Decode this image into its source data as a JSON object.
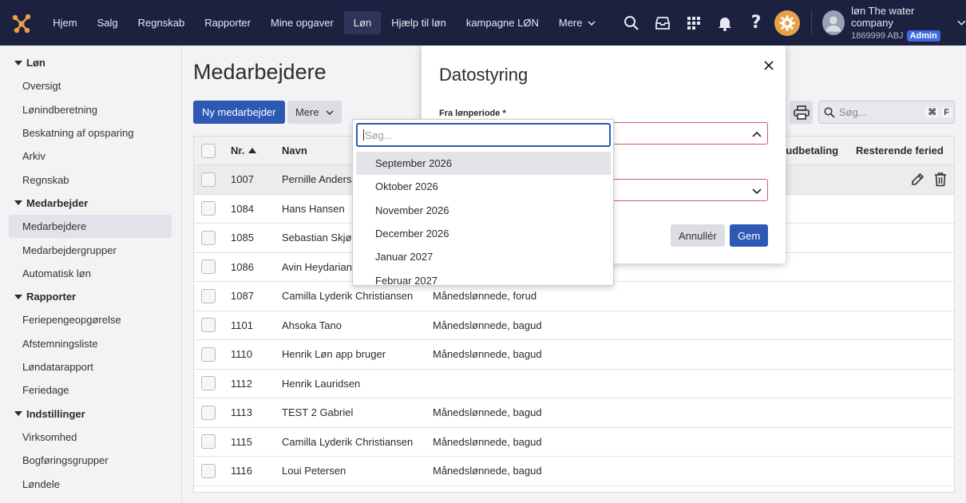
{
  "topnav": {
    "items": [
      "Hjem",
      "Salg",
      "Regnskab",
      "Rapporter",
      "Mine opgaver",
      "Løn",
      "Hjælp til løn",
      "kampagne LØN"
    ],
    "active_index": 5,
    "more_label": "Mere"
  },
  "user": {
    "name": "løn The water company",
    "sub": "1869999 ABJ",
    "role": "Admin"
  },
  "sidebar": {
    "sections": [
      {
        "title": "Løn",
        "items": [
          "Oversigt",
          "Lønindberetning",
          "Beskatning af opsparing",
          "Arkiv",
          "Regnskab"
        ]
      },
      {
        "title": "Medarbejder",
        "items": [
          "Medarbejdere",
          "Medarbejdergrupper",
          "Automatisk løn"
        ]
      },
      {
        "title": "Rapporter",
        "items": [
          "Feriepengeopgørelse",
          "Afstemningsliste",
          "Løndatarapport",
          "Feriedage"
        ]
      },
      {
        "title": "Indstillinger",
        "items": [
          "Virksomhed",
          "Bogføringsgrupper",
          "Løndele"
        ]
      }
    ],
    "active_item": "Medarbejdere"
  },
  "main": {
    "title": "Medarbejdere",
    "new_button": "Ny medarbejder",
    "more_button": "Mere",
    "search_placeholder": "Søg...",
    "search_kbd_1": "⌘",
    "search_kbd_2": "F"
  },
  "table": {
    "columns": {
      "nr": "Nr.",
      "navn": "Navn",
      "udb": "ste udbetaling",
      "rest": "Resterende feried"
    },
    "rows": [
      {
        "nr": "1007",
        "navn": "Pernille Andersen",
        "gruppe": ""
      },
      {
        "nr": "1084",
        "navn": "Hans Hansen",
        "gruppe": ""
      },
      {
        "nr": "1085",
        "navn": "Sebastian Skjødt",
        "gruppe": ""
      },
      {
        "nr": "1086",
        "navn": "Avin Heydarian",
        "gruppe": ""
      },
      {
        "nr": "1087",
        "navn": "Camilla Lyderik Christiansen",
        "gruppe": "Månedslønnede, forud"
      },
      {
        "nr": "1101",
        "navn": "Ahsoka Tano",
        "gruppe": "Månedslønnede, bagud"
      },
      {
        "nr": "1110",
        "navn": "Henrik Løn app bruger",
        "gruppe": "Månedslønnede, bagud"
      },
      {
        "nr": "1112",
        "navn": "Henrik Lauridsen",
        "gruppe": ""
      },
      {
        "nr": "1113",
        "navn": "TEST 2 Gabriel",
        "gruppe": "Månedslønnede, bagud"
      },
      {
        "nr": "1115",
        "navn": "Camilla Lyderik Christiansen",
        "gruppe": "Månedslønnede, bagud"
      },
      {
        "nr": "1116",
        "navn": "Loui Petersen",
        "gruppe": "Månedslønnede, bagud"
      }
    ]
  },
  "dialog": {
    "title": "Datostyring",
    "from_label": "Fra lønperiode *",
    "cancel": "Annullér",
    "save": "Gem"
  },
  "dropdown": {
    "search_placeholder": "Søg...",
    "options": [
      "September 2026",
      "Oktober 2026",
      "November 2026",
      "December 2026",
      "Januar 2027",
      "Februar 2027"
    ],
    "highlighted_index": 0
  },
  "colors": {
    "topbar": "#1c2140",
    "primary": "#2d59b5",
    "accent": "#e8a148",
    "error_border": "#d6556a"
  }
}
